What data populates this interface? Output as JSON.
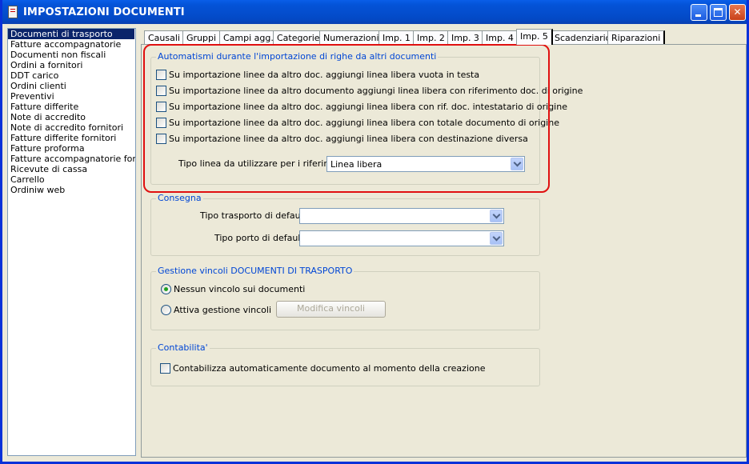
{
  "window": {
    "title": "IMPOSTAZIONI DOCUMENTI"
  },
  "sidebar": {
    "items": [
      {
        "label": "Documenti di trasporto",
        "selected": true
      },
      {
        "label": "Fatture accompagnatorie"
      },
      {
        "label": "Documenti non fiscali"
      },
      {
        "label": "Ordini a fornitori"
      },
      {
        "label": "DDT carico"
      },
      {
        "label": "Ordini clienti"
      },
      {
        "label": "Preventivi"
      },
      {
        "label": "Fatture differite"
      },
      {
        "label": "Note di accredito"
      },
      {
        "label": "Note di accredito fornitori"
      },
      {
        "label": "Fatture differite fornitori"
      },
      {
        "label": "Fatture proforma"
      },
      {
        "label": "Fatture accompagnatorie fornitori"
      },
      {
        "label": "Ricevute di cassa"
      },
      {
        "label": "Carrello"
      },
      {
        "label": "Ordiniw web"
      }
    ]
  },
  "tabs": [
    {
      "label": "Causali"
    },
    {
      "label": "Gruppi"
    },
    {
      "label": "Campi agg."
    },
    {
      "label": "Categorie"
    },
    {
      "label": "Numerazioni"
    },
    {
      "label": "Imp. 1"
    },
    {
      "label": "Imp. 2"
    },
    {
      "label": "Imp. 3"
    },
    {
      "label": "Imp. 4"
    },
    {
      "label": "Imp. 5",
      "active": true
    },
    {
      "label": "Scadenziario"
    },
    {
      "label": "Riparazioni"
    }
  ],
  "automatismi": {
    "title": "Automatismi durante l'importazione di righe da altri documenti",
    "checkboxes": [
      {
        "label": "Su importazione linee da altro doc. aggiungi linea libera vuota in testa",
        "checked": false
      },
      {
        "label": "Su importazione linee da altro documento aggiungi linea libera con riferimento doc. di origine",
        "checked": false
      },
      {
        "label": "Su importazione linee da altro doc. aggiungi linea libera con rif. doc. intestatario di origine",
        "checked": false
      },
      {
        "label": "Su importazione linee da altro doc. aggiungi linea libera con totale documento di origine",
        "checked": false
      },
      {
        "label": "Su importazione linee da altro doc. aggiungi linea libera con destinazione diversa",
        "checked": false
      }
    ],
    "tipo_linea": {
      "label": "Tipo linea da utilizzare per i riferimenti :",
      "value": "Linea libera"
    }
  },
  "consegna": {
    "title": "Consegna",
    "tipo_trasporto": {
      "label": "Tipo trasporto di default :",
      "value": ""
    },
    "tipo_porto": {
      "label": "Tipo porto di default :",
      "value": ""
    }
  },
  "vincoli": {
    "title": "Gestione vincoli DOCUMENTI DI TRASPORTO",
    "options": [
      {
        "label": "Nessun vincolo sui documenti",
        "checked": true
      },
      {
        "label": "Attiva gestione vincoli",
        "checked": false
      }
    ],
    "modifica_button": "Modifica vincoli"
  },
  "contabilita": {
    "title": "Contabilita'",
    "checkbox": {
      "label": "Contabilizza automaticamente documento al momento della creazione",
      "checked": false
    }
  },
  "colors": {
    "titlebar": "#0453d8",
    "group_title": "#0046d5",
    "selection": "#0a246a",
    "highlight": "#e01010"
  }
}
